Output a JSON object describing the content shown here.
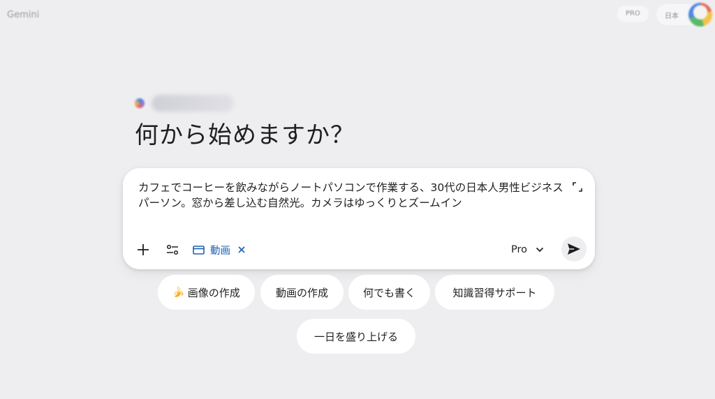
{
  "header": {
    "app_name": "Gemini",
    "plan_badge": "PRO",
    "lang_label": "日本"
  },
  "greeting": {
    "name_hidden": "",
    "headline": "何から始めますか？"
  },
  "composer": {
    "prompt_text": "カフェでコーヒーを飲みながらノートパソコンで作業する、30代の日本人男性ビジネスパーソン。窓から差し込む自然光。カメラはゆっくりとズームイン",
    "video_chip_label": "動画",
    "model_label": "Pro",
    "icons": {
      "add": "plus-icon",
      "tools": "tune-icon",
      "video": "clapperboard-icon",
      "remove": "close-icon",
      "model_dropdown": "chevron-down-icon",
      "send": "send-icon",
      "expand": "expand-icon"
    }
  },
  "suggestions": [
    {
      "label": "画像の作成",
      "icon": "banana-icon"
    },
    {
      "label": "動画の作成"
    },
    {
      "label": "何でも書く"
    },
    {
      "label": "知識習得サポート"
    },
    {
      "label": "一日を盛り上げる"
    }
  ],
  "colors": {
    "background": "#eeeef1",
    "accent_blue": "#1b5fb4",
    "surface": "#ffffff"
  }
}
